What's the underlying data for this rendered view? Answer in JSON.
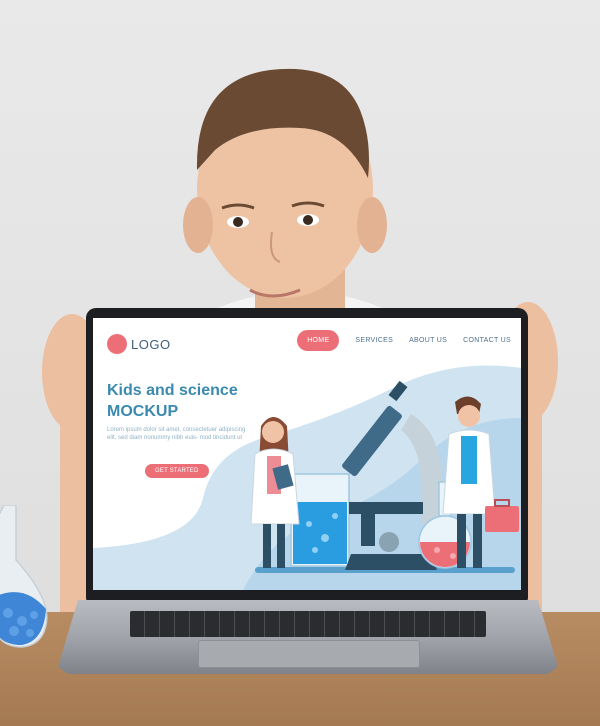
{
  "site": {
    "logo_text": "LOGO",
    "nav": [
      {
        "label": "HOME",
        "active": true
      },
      {
        "label": "SERVICES",
        "active": false
      },
      {
        "label": "ABOUT US",
        "active": false
      },
      {
        "label": "CONTACT US",
        "active": false
      }
    ],
    "hero": {
      "title_line1": "Kids and science",
      "title_line2": "MOCKUP",
      "body": "Lorem ipsum dolor sit amet, consectetuer adipiscing elit, sed diam nonummy nibh euis- mod tincidunt ut",
      "cta_label": "GET STARTED"
    }
  },
  "colors": {
    "accent": "#ec6f78",
    "title_blue": "#3a8ab0",
    "nav_text": "#4f6f8c",
    "hero_wave": "#cfe3f1"
  },
  "icons": [
    "logo-circle-icon",
    "microscope-icon",
    "beaker-icon",
    "flask-icon",
    "toolbox-icon"
  ]
}
